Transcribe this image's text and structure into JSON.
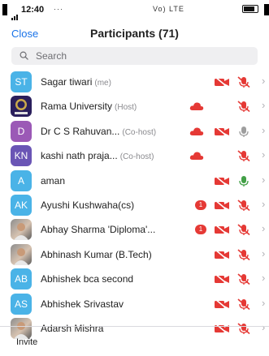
{
  "status_bar": {
    "time": "12:40",
    "left_indicators": "···",
    "right_indicators": "Vo) LTE"
  },
  "header": {
    "close_label": "Close",
    "title": "Participants (71)"
  },
  "search": {
    "placeholder": "Search"
  },
  "participants": [
    {
      "initials": "ST",
      "name": "Sagar tiwari",
      "role": "(me)",
      "avatar_color": "#4ab3e7",
      "raise": false,
      "cloud": false,
      "video_off": true,
      "mic": "muted"
    },
    {
      "initials": "",
      "name": "Rama University",
      "role": "(Host)",
      "avatar_image": "university-logo",
      "raise": false,
      "cloud": true,
      "video_off": false,
      "mic": "muted"
    },
    {
      "initials": "D",
      "name": "Dr  C S Rahuvan...",
      "role": "(Co-host)",
      "avatar_color": "#9b59b6",
      "raise": false,
      "cloud": true,
      "video_off": true,
      "mic": "unmuted-gray"
    },
    {
      "initials": "KN",
      "name": "kashi nath praja...",
      "role": "(Co-host)",
      "avatar_color": "#6a55b5",
      "raise": false,
      "cloud": true,
      "video_off": false,
      "mic": "muted"
    },
    {
      "initials": "A",
      "name": "aman",
      "role": "",
      "avatar_color": "#4ab3e7",
      "raise": false,
      "cloud": false,
      "video_off": true,
      "mic": "active-green"
    },
    {
      "initials": "AK",
      "name": "Ayushi Kushwaha(cs)",
      "role": "",
      "avatar_color": "#4ab3e7",
      "raise": true,
      "cloud": false,
      "video_off": true,
      "mic": "muted"
    },
    {
      "initials": "",
      "name": "Abhay Sharma 'Diploma'...",
      "role": "",
      "avatar_image": "photo",
      "raise": true,
      "cloud": false,
      "video_off": true,
      "mic": "muted"
    },
    {
      "initials": "",
      "name": "Abhinash Kumar (B.Tech)",
      "role": "",
      "avatar_image": "photo",
      "raise": false,
      "cloud": false,
      "video_off": true,
      "mic": "muted"
    },
    {
      "initials": "AB",
      "name": "Abhishek bca second",
      "role": "",
      "avatar_color": "#4ab3e7",
      "raise": false,
      "cloud": false,
      "video_off": true,
      "mic": "muted"
    },
    {
      "initials": "AS",
      "name": "Abhishek Srivastav",
      "role": "",
      "avatar_color": "#4ab3e7",
      "raise": false,
      "cloud": false,
      "video_off": true,
      "mic": "muted"
    },
    {
      "initials": "",
      "name": "Adarsh Mishra",
      "role": "",
      "avatar_image": "photo",
      "raise": false,
      "cloud": false,
      "video_off": true,
      "mic": "muted"
    }
  ],
  "raise_hand_count": "1",
  "footer": {
    "invite_label": "Invite"
  },
  "colors": {
    "accent": "#1a73e8",
    "muted_red": "#e53935",
    "mic_gray": "#9e9e9e",
    "mic_green": "#43a047"
  }
}
